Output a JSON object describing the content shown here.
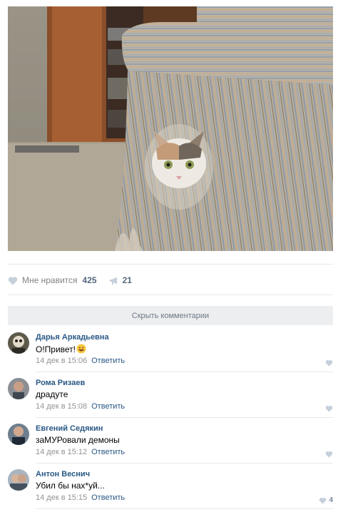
{
  "post": {
    "photo_icon": "cat-in-armchair-photo"
  },
  "actions": {
    "like_label": "Мне нравится",
    "like_count": "425",
    "share_count": "21"
  },
  "comments_toggle": "Скрыть комментарии",
  "comments": [
    {
      "name": "Дарья Аркадьевна",
      "text": "О!Привет!",
      "date": "14 дек в 15:06",
      "reply": "Ответить",
      "likes": ""
    },
    {
      "name": "Рома Ризаев",
      "text": "драдуте",
      "date": "14 дек в 15:08",
      "reply": "Ответить",
      "likes": ""
    },
    {
      "name": "Евгений Седякин",
      "text": "заМУРовали демоны",
      "date": "14 дек в 15:12",
      "reply": "Ответить",
      "likes": ""
    },
    {
      "name": "Антон Веснич",
      "text": "Убил бы нах*уй...",
      "date": "14 дек в 15:15",
      "reply": "Ответить",
      "likes": "4"
    }
  ],
  "colors": {
    "link": "#2a5885",
    "meta": "#939393",
    "like_icon": "#c5d0db",
    "toggle_bg": "#edeef0"
  }
}
